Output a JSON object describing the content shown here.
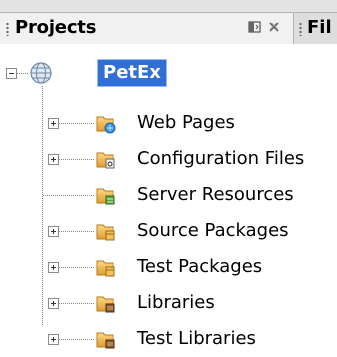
{
  "tabs": {
    "projects_label": "Projects",
    "files_label": "Fil"
  },
  "tree": {
    "root": {
      "label": "PetEx",
      "icon": "globe-icon"
    },
    "items": [
      {
        "label": "Web Pages",
        "icon": "web-pages-folder-icon",
        "expandable": true
      },
      {
        "label": "Configuration Files",
        "icon": "configuration-folder-icon",
        "expandable": true
      },
      {
        "label": "Server Resources",
        "icon": "server-resources-folder-icon",
        "expandable": false
      },
      {
        "label": "Source Packages",
        "icon": "source-packages-folder-icon",
        "expandable": true
      },
      {
        "label": "Test Packages",
        "icon": "test-packages-folder-icon",
        "expandable": true
      },
      {
        "label": "Libraries",
        "icon": "libraries-folder-icon",
        "expandable": true
      },
      {
        "label": "Test Libraries",
        "icon": "test-libraries-folder-icon",
        "expandable": true
      }
    ]
  },
  "colors": {
    "selection": "#2f6fd6",
    "folder": "#e8a93a",
    "tab_background": "#f1f1f1"
  }
}
